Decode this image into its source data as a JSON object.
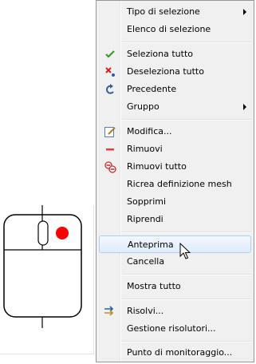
{
  "menu": {
    "tipo_selezione": "Tipo di selezione",
    "elenco_selezione": "Elenco di selezione",
    "seleziona_tutto": "Seleziona tutto",
    "deseleziona_tutto": "Deseleziona tutto",
    "precedente": "Precedente",
    "gruppo": "Gruppo",
    "modifica": "Modifica...",
    "rimuovi": "Rimuovi",
    "rimuovi_tutto": "Rimuovi tutto",
    "ricrea_mesh": "Ricrea definizione mesh",
    "sopprimi": "Sopprimi",
    "riprendi": "Riprendi",
    "anteprima": "Anteprima",
    "cancella": "Cancella",
    "mostra_tutto": "Mostra tutto",
    "risolvi": "Risolvi...",
    "gestione_risolutori": "Gestione risolutori...",
    "punto_monitoraggio": "Punto di monitoraggio..."
  },
  "colors": {
    "menu_bg": "#f0f0f0",
    "highlight_border": "#aecff7",
    "mouse_right_button": "#ff0000"
  },
  "icons": {
    "seleziona_tutto": "green-check-icon",
    "deseleziona_tutto": "red-x-icon",
    "precedente": "undo-arrow-icon",
    "modifica": "edit-pencil-icon",
    "rimuovi": "minus-icon",
    "rimuovi_tutto": "remove-all-icon",
    "risolvi": "solve-arrows-icon"
  }
}
